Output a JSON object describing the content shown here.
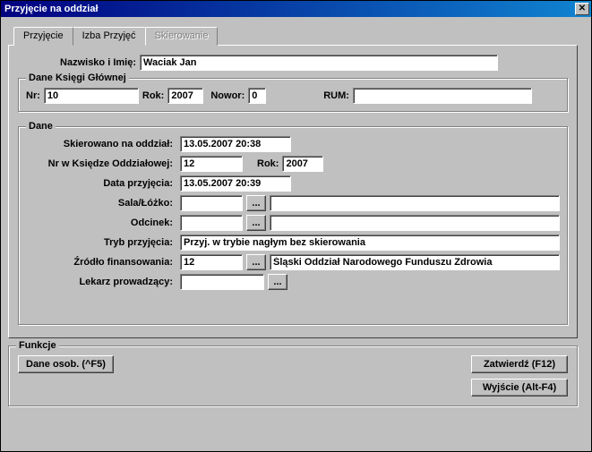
{
  "title": "Przyjęcie na oddział",
  "tabs": {
    "t0": "Przyjęcie",
    "t1": "Izba Przyjęć",
    "t2": "Skierowanie"
  },
  "name_label": "Nazwisko i Imię:",
  "name_value": "Waciak Jan",
  "ksiega": {
    "legend": "Dane Księgi Głównej",
    "nr_label": "Nr:",
    "nr_value": "10",
    "rok_label": "Rok:",
    "rok_value": "2007",
    "nowor_label": "Nowor:",
    "nowor_value": "0",
    "rum_label": "RUM:",
    "rum_value": ""
  },
  "dane": {
    "legend": "Dane",
    "skier_label": "Skierowano na oddział:",
    "skier_value": "13.05.2007 20:38",
    "nrko_label": "Nr w Księdze Oddziałowej:",
    "nrko_value": "12",
    "nrko_rok_label": "Rok:",
    "nrko_rok_value": "2007",
    "dataprz_label": "Data przyjęcia:",
    "dataprz_value": "13.05.2007 20:39",
    "sala_label": "Sala/Łóżko:",
    "sala_value": "",
    "sala_desc": "",
    "odcinek_label": "Odcinek:",
    "odcinek_value": "",
    "odcinek_desc": "",
    "tryb_label": "Tryb przyjęcia:",
    "tryb_value": "Przyj. w trybie nagłym bez skierowania",
    "zrodlo_label": "Źródło finansowania:",
    "zrodlo_value": "12",
    "zrodlo_desc": "Śląski Oddział Narodowego Funduszu Zdrowia",
    "lekarz_label": "Lekarz prowadzący:",
    "lekarz_value": "",
    "browse": "..."
  },
  "funkcje": {
    "legend": "Funkcje",
    "dane_osob": "Dane osob. (^F5)",
    "zatwierdz": "Zatwierdź (F12)",
    "wyjscie": "Wyjście (Alt-F4)"
  }
}
